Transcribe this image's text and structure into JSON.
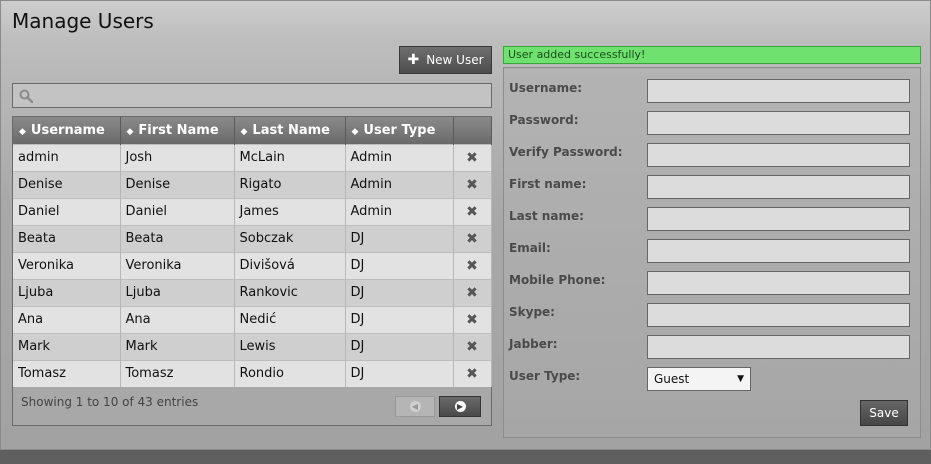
{
  "page": {
    "title": "Manage Users"
  },
  "toolbar": {
    "new_user_label": "New User"
  },
  "search": {
    "value": "",
    "placeholder": ""
  },
  "table": {
    "columns": [
      "Username",
      "First Name",
      "Last Name",
      "User Type"
    ],
    "rows": [
      [
        "admin",
        "Josh",
        "McLain",
        "Admin"
      ],
      [
        "Denise",
        "Denise",
        "Rigato",
        "Admin"
      ],
      [
        "Daniel",
        "Daniel",
        "James",
        "Admin"
      ],
      [
        "Beata",
        "Beata",
        "Sobczak",
        "DJ"
      ],
      [
        "Veronika",
        "Veronika",
        "Divišová",
        "DJ"
      ],
      [
        "Ljuba",
        "Ljuba",
        "Rankovic",
        "DJ"
      ],
      [
        "Ana",
        "Ana",
        "Nedić",
        "DJ"
      ],
      [
        "Mark",
        "Mark",
        "Lewis",
        "DJ"
      ],
      [
        "Tomasz",
        "Tomasz",
        "Rondio",
        "DJ"
      ]
    ],
    "info": "Showing 1 to 10 of 43 entries"
  },
  "status": {
    "message": "User added successfully!",
    "color": "#6ee16e"
  },
  "form": {
    "fields": [
      {
        "label": "Username:",
        "value": ""
      },
      {
        "label": "Password:",
        "value": ""
      },
      {
        "label": "Verify Password:",
        "value": ""
      },
      {
        "label": "First name:",
        "value": ""
      },
      {
        "label": "Last name:",
        "value": ""
      },
      {
        "label": "Email:",
        "value": ""
      },
      {
        "label": "Mobile Phone:",
        "value": ""
      },
      {
        "label": "Skype:",
        "value": ""
      },
      {
        "label": "Jabber:",
        "value": ""
      }
    ],
    "user_type_label": "User Type:",
    "user_type_value": "Guest",
    "save_label": "Save"
  }
}
